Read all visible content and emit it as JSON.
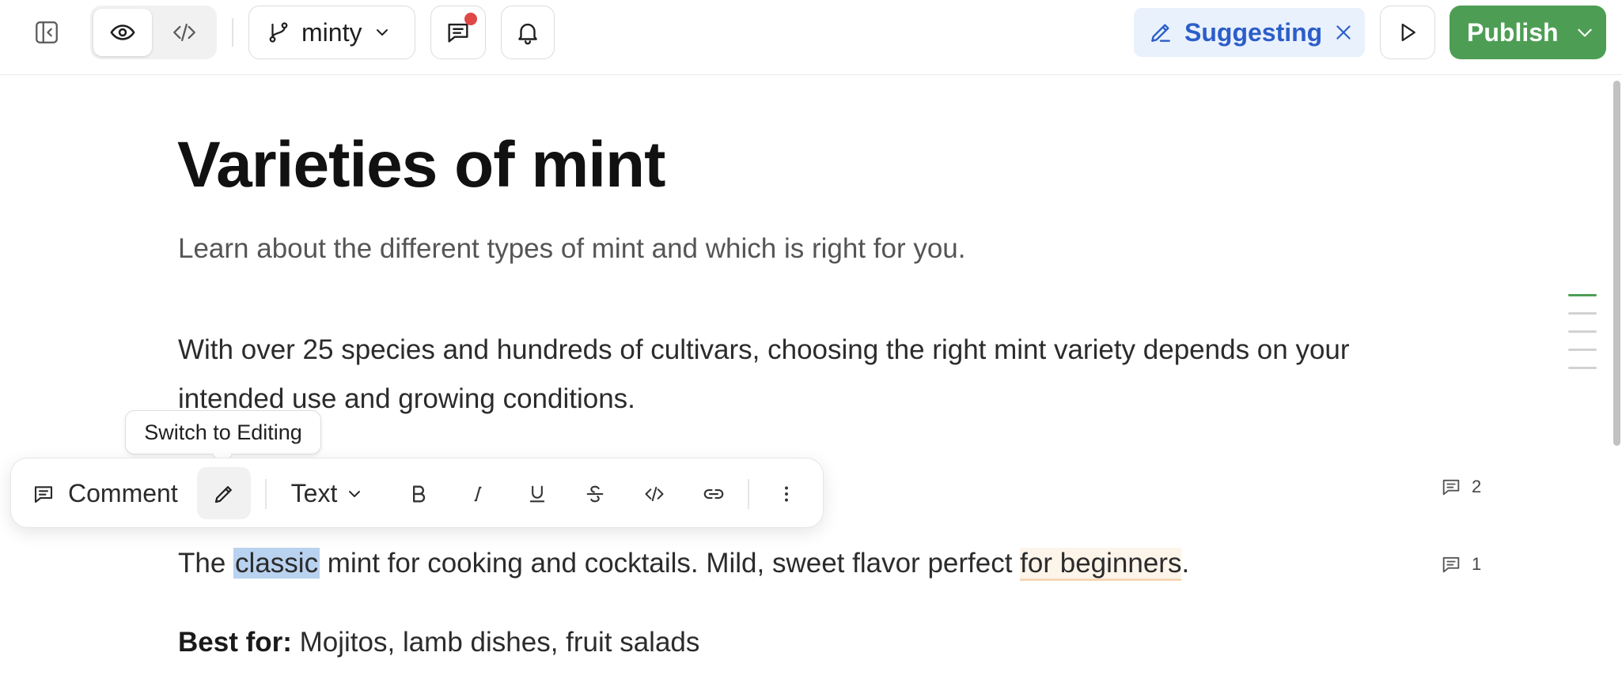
{
  "topbar": {
    "sidebar_toggle_icon": "sidebar-collapse-icon",
    "view_modes": [
      "preview-eye-icon",
      "code-icon"
    ],
    "branch_name": "minty",
    "comments_has_unread": true,
    "mode_label": "Suggesting",
    "publish_label": "Publish"
  },
  "document": {
    "title": "Varieties of mint",
    "subtitle": "Learn about the different types of mint and which is right for you.",
    "paragraph": "With over 25 species and hundreds of cultivars, choosing the right mint variety depends on your intended use and growing conditions.",
    "sentence": {
      "before": "The ",
      "selected": "classic",
      "middle": " mint for cooking and cocktails. Mild, sweet flavor perfect ",
      "suggested": "for beginners",
      "after": "."
    },
    "best_for_label": "Best for:",
    "best_for_value": " Mojitos, lamb dishes, fruit salads"
  },
  "comment_counts": [
    "2",
    "1"
  ],
  "toolbar": {
    "comment_label": "Comment",
    "tooltip": "Switch to Editing",
    "text_style_label": "Text"
  },
  "colors": {
    "accent_green": "#4d9e54",
    "suggesting_blue": "#2c5ec9",
    "selection": "#b9d2ef"
  }
}
